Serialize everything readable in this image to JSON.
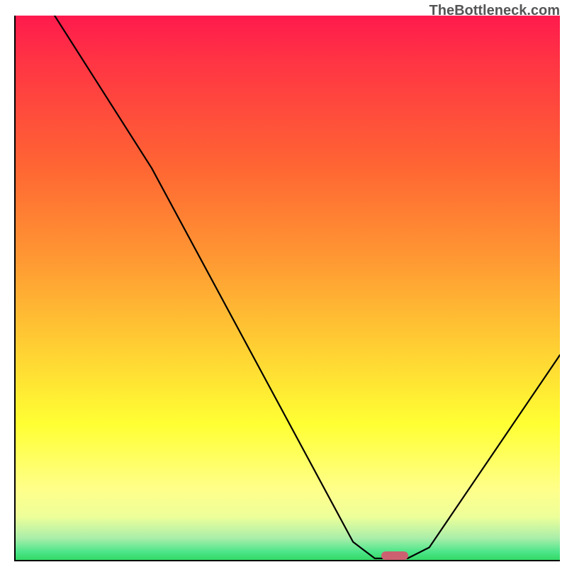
{
  "watermark": "TheBottleneck.com",
  "chart_data": {
    "type": "line",
    "title": "",
    "xlabel": "",
    "ylabel": "",
    "xlim": [
      0,
      100
    ],
    "ylim": [
      0,
      100
    ],
    "series": [
      {
        "name": "curve",
        "style": "black-line",
        "points": [
          {
            "x": 7,
            "y": 100
          },
          {
            "x": 25,
            "y": 72
          },
          {
            "x": 62,
            "y": 4
          },
          {
            "x": 66,
            "y": 1
          },
          {
            "x": 72,
            "y": 1
          },
          {
            "x": 76,
            "y": 3
          },
          {
            "x": 100,
            "y": 38
          }
        ]
      }
    ],
    "marker": {
      "x_start": 67,
      "x_end": 72,
      "y": 0.8
    },
    "background": "vertical-gradient red→yellow→green",
    "grid": false,
    "legend": false
  }
}
